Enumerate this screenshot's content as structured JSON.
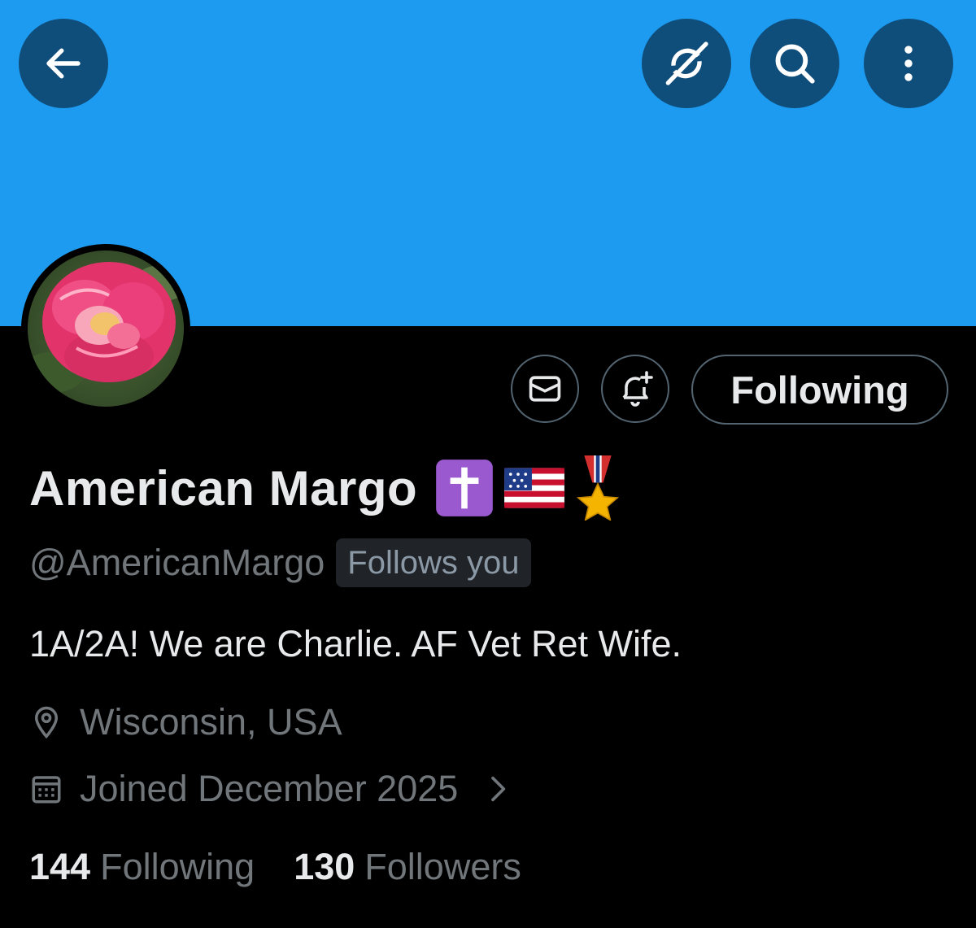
{
  "colors": {
    "banner": "#1d9bf0",
    "button_bg": "#0f4d7a",
    "background": "#000000",
    "primary_text": "#e7e9ea",
    "secondary_text": "#71767b",
    "border": "#536471"
  },
  "header": {
    "back_icon": "arrow-left-icon",
    "grok_icon": "grok-icon",
    "search_icon": "search-icon",
    "more_icon": "more-vertical-icon"
  },
  "profile": {
    "avatar": "rose-photo",
    "display_name": "American Margo",
    "name_emojis": [
      "latin-cross-emoji",
      "us-flag-emoji",
      "military-medal-emoji"
    ],
    "handle": "@AmericanMargo",
    "follows_you_badge": "Follows you",
    "bio": "1A/2A! We are Charlie. AF Vet Ret Wife.",
    "location": "Wisconsin, USA",
    "joined": "Joined December 2025"
  },
  "actions": {
    "message_icon": "envelope-icon",
    "notify_icon": "bell-plus-icon",
    "following_label": "Following"
  },
  "stats": {
    "following_count": "144",
    "following_label": "Following",
    "followers_count": "130",
    "followers_label": "Followers"
  }
}
